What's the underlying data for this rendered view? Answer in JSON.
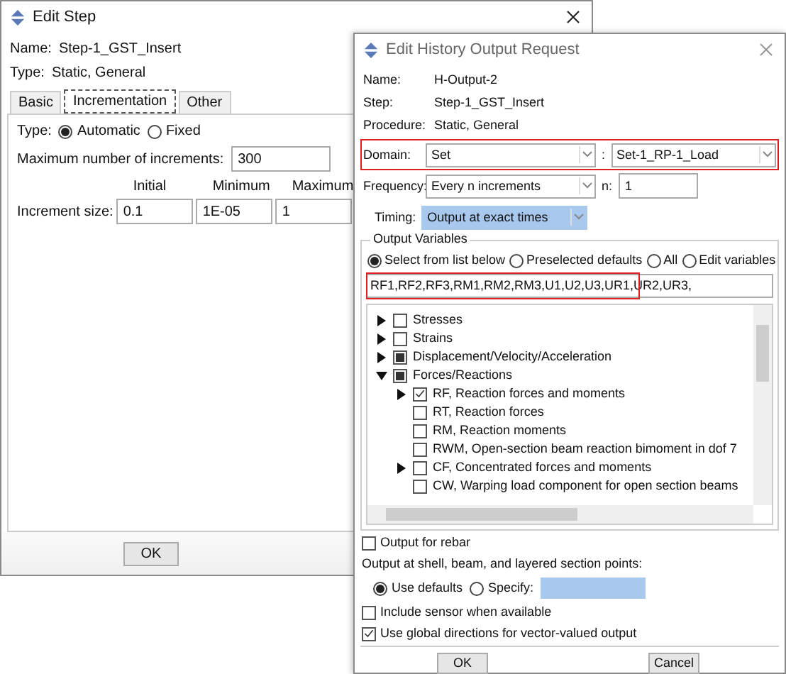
{
  "edit_step": {
    "title": "Edit Step",
    "info": [
      {
        "label": "Name:",
        "value": "Step-1_GST_Insert"
      },
      {
        "label": "Type:",
        "value": "Static, General"
      }
    ],
    "tabs": [
      {
        "label": "Basic",
        "selected": false
      },
      {
        "label": "Incrementation",
        "selected": true
      },
      {
        "label": "Other",
        "selected": false
      }
    ],
    "type_label": "Type:",
    "type_options": [
      {
        "label": "Automatic",
        "selected": true
      },
      {
        "label": "Fixed",
        "selected": false
      }
    ],
    "max_increments": {
      "label": "Maximum number of increments:",
      "value": "300"
    },
    "increment_headers": [
      "Initial",
      "Minimum",
      "Maximum"
    ],
    "increment_size": {
      "label": "Increment size:",
      "values": [
        "0.1",
        "1E-05",
        "1"
      ]
    },
    "button": "OK"
  },
  "history_output": {
    "title": "Edit History Output Request",
    "info": [
      {
        "label": "Name:",
        "value": "H-Output-2"
      },
      {
        "label": "Step:",
        "value": "Step-1_GST_Insert"
      },
      {
        "label": "Procedure:",
        "value": "Static, General"
      }
    ],
    "domain": {
      "label": "Domain:",
      "value": "Set",
      "separator": ":",
      "set_value": "Set-1_RP-1_Load",
      "highlighted": true
    },
    "frequency": {
      "label": "Frequency:",
      "value": "Every n increments",
      "n_label": "n:",
      "n_value": "1"
    },
    "timing": {
      "label": "Timing:",
      "value": "Output at exact times"
    },
    "output_variables": {
      "legend": "Output Variables",
      "options": [
        {
          "label": "Select from list below",
          "selected": true
        },
        {
          "label": "Preselected defaults",
          "selected": false
        },
        {
          "label": "All",
          "selected": false
        },
        {
          "label": "Edit variables",
          "selected": false
        }
      ],
      "value": "RF1,RF2,RF3,RM1,RM2,RM3,U1,U2,U3,UR1,UR2,UR3,",
      "highlighted": true,
      "tree": [
        {
          "label": "Stresses",
          "checked": false,
          "partial": false,
          "expanded": false
        },
        {
          "label": "Strains",
          "checked": false,
          "partial": false,
          "expanded": false
        },
        {
          "label": "Displacement/Velocity/Acceleration",
          "checked": false,
          "partial": true,
          "expanded": false
        },
        {
          "label": "Forces/Reactions",
          "checked": false,
          "partial": true,
          "expanded": true,
          "children": [
            {
              "label": "RF, Reaction forces and moments",
              "checked": true,
              "partial": false,
              "expanded": false
            },
            {
              "label": "RT, Reaction forces",
              "checked": false,
              "partial": false
            },
            {
              "label": "RM, Reaction moments",
              "checked": false,
              "partial": false
            },
            {
              "label": "RWM, Open-section beam reaction bimoment in dof 7",
              "checked": false,
              "partial": false
            },
            {
              "label": "CF, Concentrated forces and moments",
              "checked": false,
              "partial": false,
              "expanded": false
            },
            {
              "label": "CW, Warping load component for open section beams",
              "checked": false,
              "partial": false
            }
          ]
        }
      ]
    },
    "rebar": {
      "label": "Output for rebar",
      "checked": false
    },
    "section_points": {
      "label": "Output at shell, beam, and layered section points:",
      "options": [
        {
          "label": "Use defaults",
          "selected": true
        },
        {
          "label": "Specify:",
          "selected": false
        }
      ]
    },
    "sensor": {
      "label": "Include sensor when available",
      "checked": false
    },
    "global_directions": {
      "label": "Use global directions for vector-valued output",
      "checked": true
    },
    "buttons": [
      "OK",
      "Cancel"
    ]
  }
}
